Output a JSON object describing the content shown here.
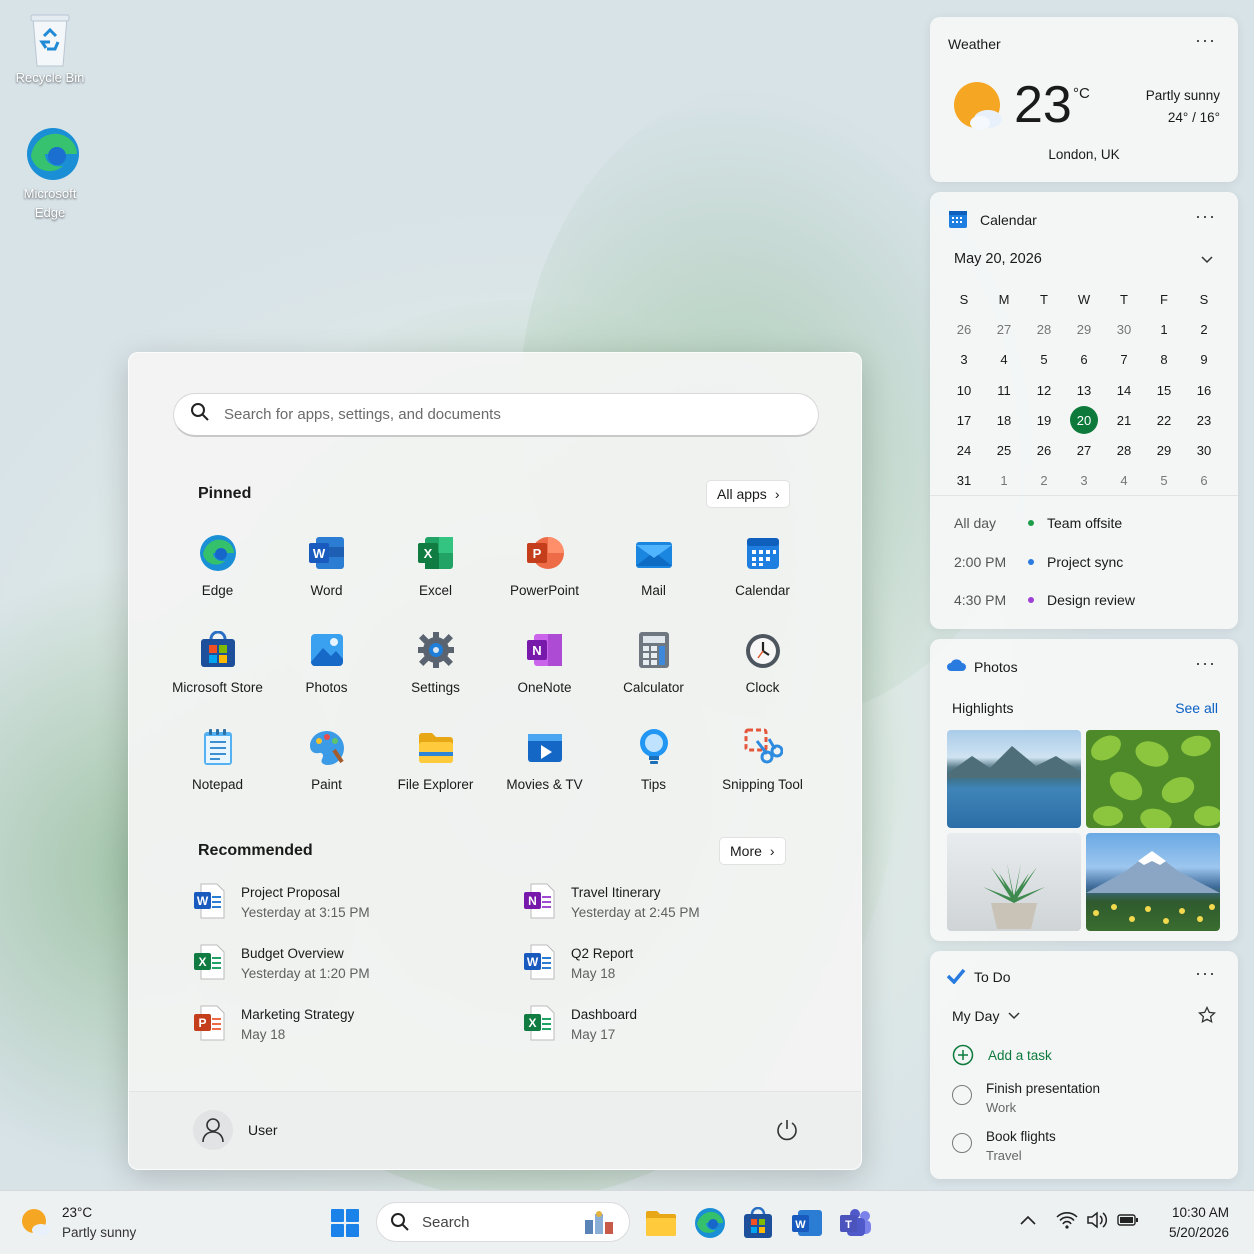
{
  "desktop": {
    "icons": [
      {
        "label": "Recycle Bin"
      },
      {
        "label": "Microsoft Edge"
      }
    ]
  },
  "start_menu": {
    "search_placeholder": "Search for apps, settings, and documents",
    "pinned_title": "Pinned",
    "all_apps_label": "All apps",
    "pinned_apps": [
      {
        "label": "Edge",
        "icon": "edge-icon"
      },
      {
        "label": "Word",
        "icon": "word-icon"
      },
      {
        "label": "Excel",
        "icon": "excel-icon"
      },
      {
        "label": "PowerPoint",
        "icon": "powerpoint-icon"
      },
      {
        "label": "Mail",
        "icon": "mail-icon"
      },
      {
        "label": "Calendar",
        "icon": "calendar-icon"
      },
      {
        "label": "Microsoft Store",
        "icon": "store-icon"
      },
      {
        "label": "Photos",
        "icon": "photos-icon"
      },
      {
        "label": "Settings",
        "icon": "settings-icon"
      },
      {
        "label": "OneNote",
        "icon": "onenote-icon"
      },
      {
        "label": "Calculator",
        "icon": "calculator-icon"
      },
      {
        "label": "Clock",
        "icon": "clock-icon"
      },
      {
        "label": "Notepad",
        "icon": "notepad-icon"
      },
      {
        "label": "Paint",
        "icon": "paint-icon"
      },
      {
        "label": "File Explorer",
        "icon": "folder-icon"
      },
      {
        "label": "Movies & TV",
        "icon": "movies-icon"
      },
      {
        "label": "Tips",
        "icon": "tips-icon"
      },
      {
        "label": "Snipping Tool",
        "icon": "snipping-icon"
      }
    ],
    "recommended_title": "Recommended",
    "more_label": "More",
    "recommended": [
      {
        "name": "Project Proposal",
        "time": "Yesterday at 3:15 PM",
        "icon": "word-file-icon"
      },
      {
        "name": "Travel Itinerary",
        "time": "Yesterday at 2:45 PM",
        "icon": "onenote-file-icon"
      },
      {
        "name": "Budget Overview",
        "time": "Yesterday at 1:20 PM",
        "icon": "excel-file-icon"
      },
      {
        "name": "Q2 Report",
        "time": "May 18",
        "icon": "word-file-icon"
      },
      {
        "name": "Marketing Strategy",
        "time": "May 18",
        "icon": "powerpoint-file-icon"
      },
      {
        "name": "Dashboard",
        "time": "May 17",
        "icon": "excel-file-icon"
      }
    ],
    "user_name": "User"
  },
  "weather": {
    "title": "Weather",
    "temp": "23",
    "unit": "°C",
    "condition": "Partly sunny",
    "range": "24° / 16°",
    "location": "London, UK"
  },
  "calendar": {
    "title": "Calendar",
    "date_label": "May 20, 2026",
    "weekdays": [
      "S",
      "M",
      "T",
      "W",
      "T",
      "F",
      "S"
    ],
    "days": [
      "26",
      "27",
      "28",
      "29",
      "30",
      "1",
      "2",
      "3",
      "4",
      "5",
      "6",
      "7",
      "8",
      "9",
      "10",
      "11",
      "12",
      "13",
      "14",
      "15",
      "16",
      "17",
      "18",
      "19",
      "20",
      "21",
      "22",
      "23",
      "24",
      "25",
      "26",
      "27",
      "28",
      "29",
      "30",
      "31",
      "1",
      "2",
      "3",
      "4",
      "5",
      "6"
    ],
    "today_index": 24,
    "events": [
      {
        "time": "All day",
        "title": "Team offsite",
        "color": "#1e9e4a"
      },
      {
        "time": "2:00 PM",
        "title": "Project sync",
        "color": "#2a7be0"
      },
      {
        "time": "4:30 PM",
        "title": "Design review",
        "color": "#9b3fd6"
      }
    ]
  },
  "photos": {
    "title": "Photos",
    "section": "Highlights",
    "see_all": "See all"
  },
  "todo": {
    "title": "To Do",
    "list_name": "My Day",
    "add_task": "Add a task",
    "tasks": [
      {
        "title": "Finish presentation",
        "list": "Work"
      },
      {
        "title": "Book flights",
        "list": "Travel"
      }
    ]
  },
  "taskbar": {
    "weather_temp": "23°C",
    "weather_condition": "Partly sunny",
    "search_label": "Search",
    "time": "10:30 AM",
    "date": "5/20/2026"
  }
}
